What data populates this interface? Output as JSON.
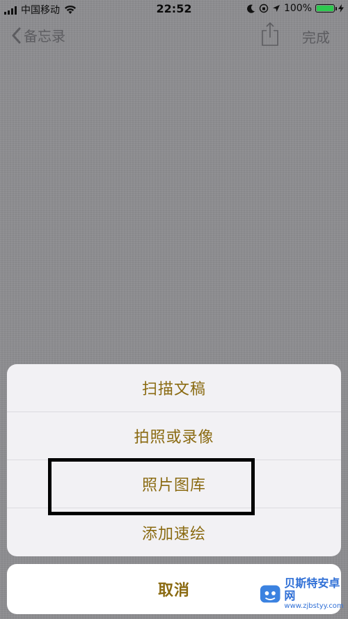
{
  "status_bar": {
    "carrier": "中国移动",
    "time": "22:52",
    "battery_percent": "100%",
    "battery_color": "#2ec94f"
  },
  "nav": {
    "back_label": "备忘录",
    "done_label": "完成",
    "share_icon": "share-icon"
  },
  "action_sheet": {
    "items": [
      {
        "label": "扫描文稿"
      },
      {
        "label": "拍照或录像"
      },
      {
        "label": "照片图库"
      },
      {
        "label": "添加速绘"
      }
    ],
    "cancel_label": "取消",
    "accent_color": "#8a6a11"
  },
  "highlight": {
    "target": "照片图库"
  },
  "watermark": {
    "title": "贝斯特安卓网",
    "url": "www.zjbstyy.com"
  }
}
